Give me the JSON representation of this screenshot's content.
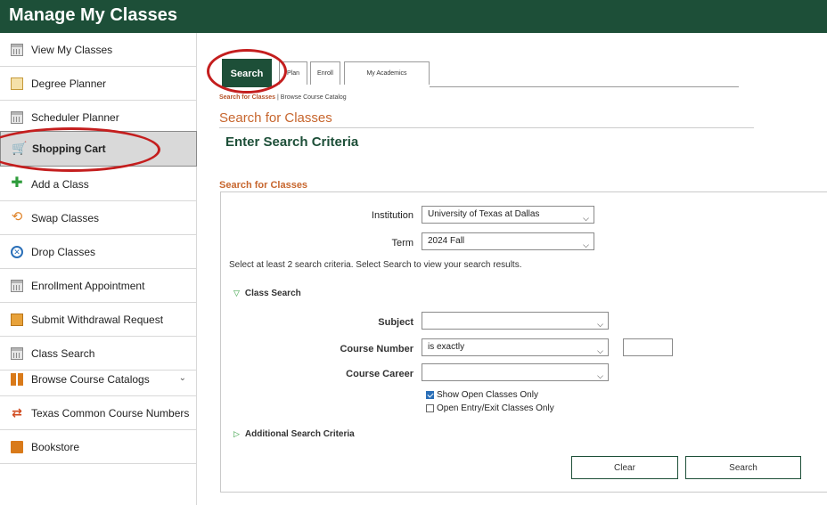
{
  "header": {
    "title": "Manage My Classes"
  },
  "sidebar": {
    "items": [
      {
        "label": "View My Classes",
        "icon": "calendar-icon"
      },
      {
        "label": "Degree Planner",
        "icon": "planner-icon"
      },
      {
        "label": "Scheduler Planner",
        "icon": "calendar-icon"
      },
      {
        "label": "Shopping Cart",
        "icon": "shopping-cart-icon",
        "active": true
      },
      {
        "label": "Add a Class",
        "icon": "plus-icon"
      },
      {
        "label": "Swap Classes",
        "icon": "swap-icon"
      },
      {
        "label": "Drop Classes",
        "icon": "drop-icon"
      },
      {
        "label": "Enrollment Appointment",
        "icon": "calendar-icon"
      },
      {
        "label": "Submit Withdrawal Request",
        "icon": "document-icon"
      },
      {
        "label": "Class Search",
        "icon": "calendar-icon"
      },
      {
        "label": "Browse Course Catalogs",
        "icon": "book-icon"
      },
      {
        "label": "Texas Common Course Numbers",
        "icon": "transfer-arrows-icon"
      },
      {
        "label": "Bookstore",
        "icon": "bookstore-icon"
      }
    ]
  },
  "tabs": [
    {
      "label": "Search",
      "active": true
    },
    {
      "label": "Plan"
    },
    {
      "label": "Enroll"
    },
    {
      "label": "My Academics"
    }
  ],
  "subnav": {
    "link1": "Search for Classes",
    "separator": "|",
    "link2": "Browse Course Catalog"
  },
  "page": {
    "heading": "Search for Classes",
    "section_title": "Enter Search Criteria",
    "panel_label": "Search for Classes"
  },
  "form": {
    "institution": {
      "label": "Institution",
      "value": "University of Texas at Dallas"
    },
    "term": {
      "label": "Term",
      "value": "2024 Fall"
    },
    "note": "Select at least 2 search criteria. Select Search to view your search results.",
    "class_search_label": "Class Search",
    "subject": {
      "label": "Subject",
      "value": ""
    },
    "course_number": {
      "label": "Course Number",
      "operator": "is exactly",
      "value": ""
    },
    "course_career": {
      "label": "Course Career",
      "value": ""
    },
    "show_open": {
      "label": "Show Open Classes Only",
      "checked": true
    },
    "open_entry": {
      "label": "Open Entry/Exit Classes Only",
      "checked": false
    },
    "additional_label": "Additional Search Criteria",
    "clear_label": "Clear",
    "search_label": "Search"
  },
  "colors": {
    "brand_green": "#1d4f38",
    "accent_orange": "#c7662e",
    "highlight_red": "#c41e1e"
  }
}
